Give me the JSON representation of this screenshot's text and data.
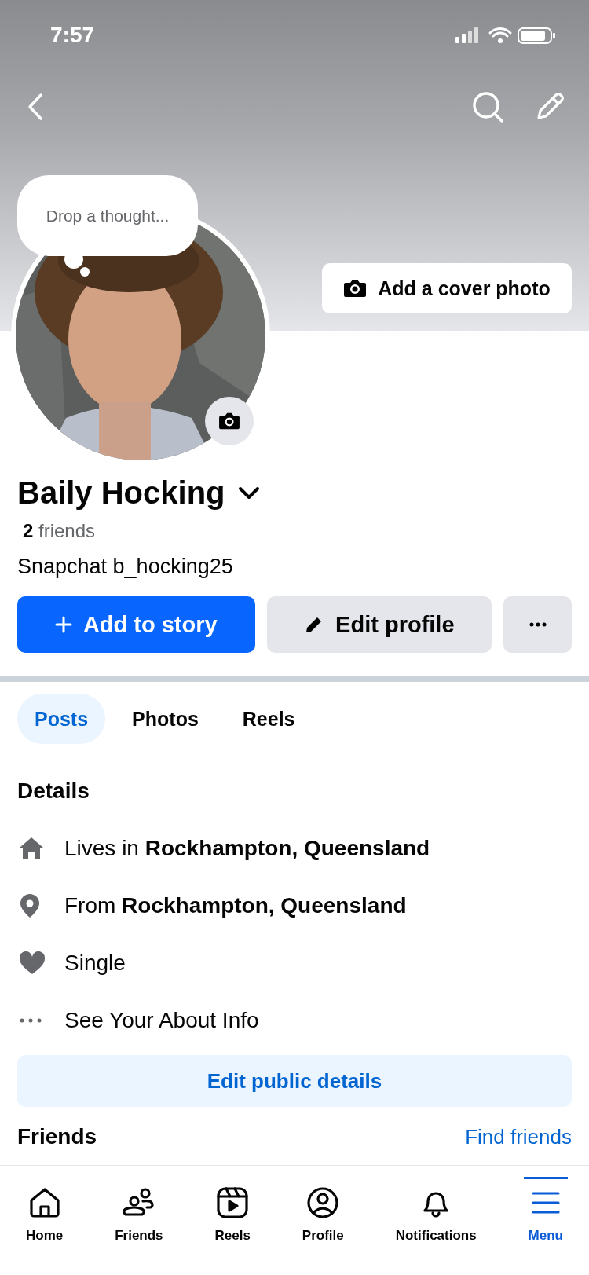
{
  "status_bar": {
    "time": "7:57"
  },
  "profile": {
    "thought_placeholder": "Drop a thought...",
    "cover_button": "Add a cover photo",
    "name": "Baily Hocking",
    "friends": "**2** friends",
    "bio": "Snapchat b_hocking25"
  },
  "actions": [
    {
      "kind": "story",
      "label": "Add to story"
    },
    {
      "kind": "edit",
      "label": "Edit profile"
    },
    {
      "kind": "more"
    }
  ],
  "tabs": [
    {
      "label": "Posts",
      "selected": true
    },
    {
      "label": "Photos",
      "selected": false
    },
    {
      "label": "Reels",
      "selected": false
    }
  ],
  "details": {
    "title": "Details",
    "items": [
      {
        "kind": "home",
        "text": "Lives in **Rockhampton, Queensland**"
      },
      {
        "kind": "pin",
        "text": "From **Rockhampton, Queensland**"
      },
      {
        "kind": "heart",
        "text": "Single"
      },
      {
        "kind": "more",
        "text": "See Your About Info"
      }
    ],
    "button": "Edit public details"
  },
  "friends_section": {
    "title": "Friends",
    "link": "Find friends"
  },
  "nav": [
    {
      "kind": "home",
      "label": "Home",
      "selected": false
    },
    {
      "kind": "friends",
      "label": "Friends",
      "selected": false
    },
    {
      "kind": "reels",
      "label": "Reels",
      "selected": false
    },
    {
      "kind": "profile",
      "label": "Profile",
      "selected": false
    },
    {
      "kind": "notifications",
      "label": "Notifications",
      "selected": false
    },
    {
      "kind": "menu",
      "label": "Menu",
      "selected": true
    }
  ]
}
